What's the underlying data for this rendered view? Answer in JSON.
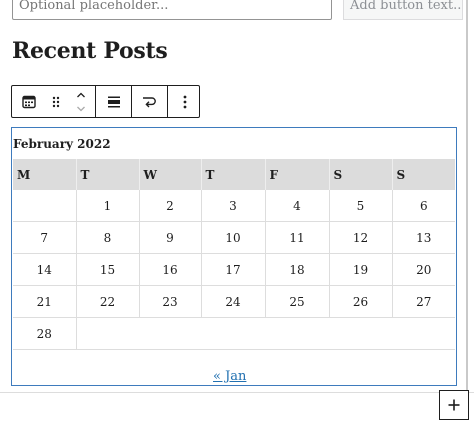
{
  "search": {
    "placeholder": "Optional placeholder...",
    "button_label": "Add button text..."
  },
  "heading": "Recent Posts",
  "toolbar": {
    "buttons": [
      "block-type-calendar-icon",
      "drag-handle-icon",
      "move-up-down-icon",
      "align-icon",
      "transform-icon",
      "more-options-icon"
    ]
  },
  "calendar": {
    "caption": "February 2022",
    "weekdays": [
      "M",
      "T",
      "W",
      "T",
      "F",
      "S",
      "S"
    ],
    "weeks": [
      [
        "",
        "1",
        "2",
        "3",
        "4",
        "5",
        "6"
      ],
      [
        "7",
        "8",
        "9",
        "10",
        "11",
        "12",
        "13"
      ],
      [
        "14",
        "15",
        "16",
        "17",
        "18",
        "19",
        "20"
      ],
      [
        "21",
        "22",
        "23",
        "24",
        "25",
        "26",
        "27"
      ],
      [
        "28",
        "",
        "",
        "",
        "",
        "",
        ""
      ]
    ],
    "prev_link": "« Jan"
  },
  "add_block": "+",
  "colors": {
    "link": "#2271b1",
    "header_bg": "#dcdcdc",
    "block_outline": "#3e7bbd"
  }
}
